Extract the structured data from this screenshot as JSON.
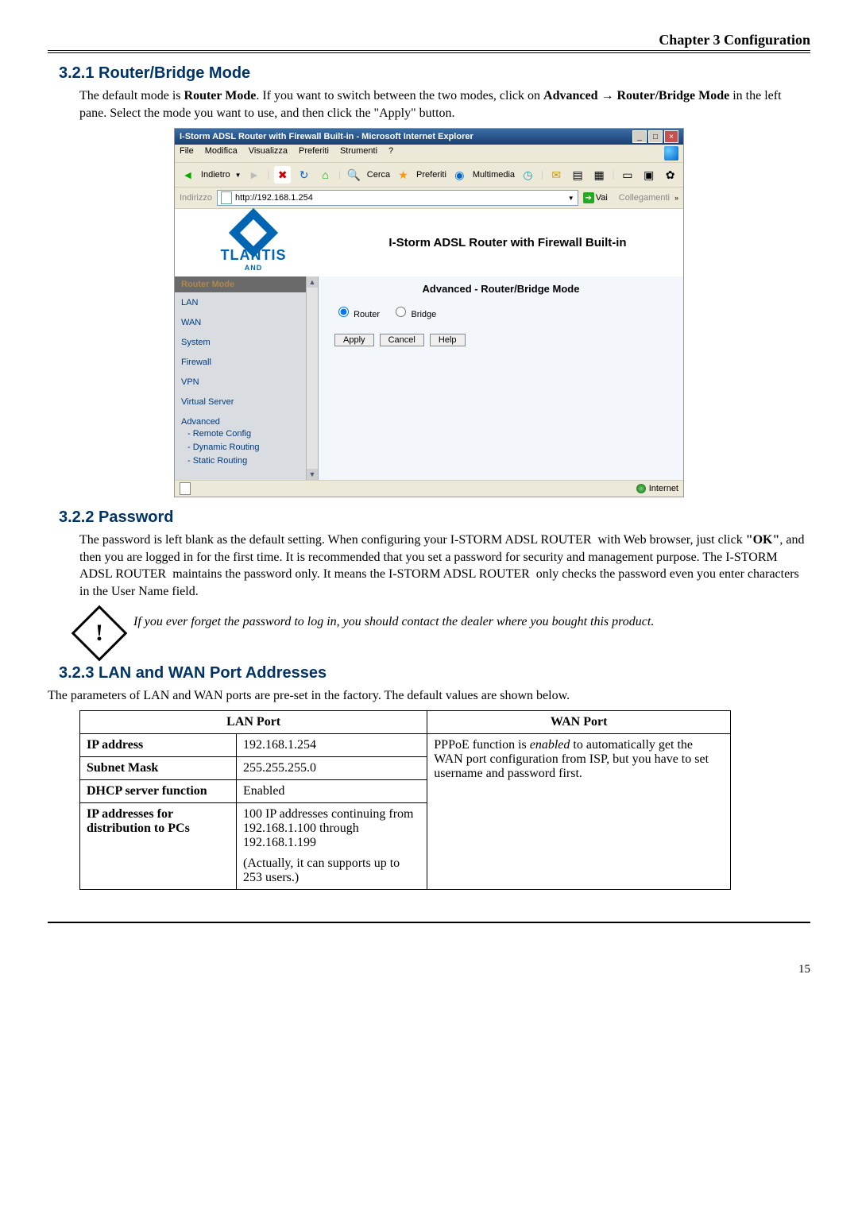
{
  "chapter_header": "Chapter 3 Configuration",
  "section_321": {
    "title": "3.2.1 Router/Bridge Mode",
    "para": "The default mode is Router Mode. If you want to switch between the two modes, click on Advanced → Router/Bridge Mode in the left pane. Select the mode you want to use, and then click the \"Apply\" button."
  },
  "screenshot": {
    "titlebar": "I-Storm ADSL Router with Firewall Built-in - Microsoft Internet Explorer",
    "menubar": [
      "File",
      "Modifica",
      "Visualizza",
      "Preferiti",
      "Strumenti",
      "?"
    ],
    "toolbar": {
      "back": "Indietro",
      "search": "Cerca",
      "fav": "Preferiti",
      "media": "Multimedia"
    },
    "address": {
      "label": "Indirizzo",
      "value": "http://192.168.1.254",
      "go": "Vai",
      "links": "Collegamenti"
    },
    "brand": "TLANTIS",
    "brand_sub": "AND",
    "page_title": "I-Storm ADSL Router with Firewall Built-in",
    "nav": {
      "top": "Router Mode",
      "items": [
        "LAN",
        "WAN",
        "System",
        "Firewall",
        "VPN",
        "Virtual Server",
        "Advanced"
      ],
      "subs": [
        "- Remote Config",
        "- Dynamic Routing",
        "- Static Routing"
      ]
    },
    "body": {
      "title": "Advanced - Router/Bridge Mode",
      "opt_router": "Router",
      "opt_bridge": "Bridge",
      "apply": "Apply",
      "cancel": "Cancel",
      "help": "Help"
    },
    "status": {
      "done_icon": "page",
      "zone": "Internet"
    }
  },
  "section_322": {
    "title": "3.2.2 Password",
    "para": "The password is left blank as the default setting. When configuring your I-STORM ADSL ROUTER  with Web browser, just click \"OK\", and then you are logged in for the first time. It is recommended that you set a password for security and management purpose. The I-STORM ADSL ROUTER  maintains the password only. It means the I-STORM ADSL ROUTER  only checks the password even you enter characters in the User Name field.",
    "note": "If you ever forget the password to log in, you should contact the dealer where you bought this product."
  },
  "section_323": {
    "title": "3.2.3 LAN and WAN Port Addresses",
    "intro": "The parameters of LAN and WAN ports are pre-set in the factory.  The default values are shown below.",
    "table": {
      "lan_header": "LAN Port",
      "wan_header": "WAN Port",
      "rows": {
        "ip_label": "IP address",
        "ip_value": "192.168.1.254",
        "mask_label": "Subnet Mask",
        "mask_value": "255.255.255.0",
        "dhcp_label": "DHCP server function",
        "dhcp_value": "Enabled",
        "dist_label": "IP addresses for distribution to PCs",
        "dist_value1": "100 IP addresses continuing from 192.168.1.100 through 192.168.1.199",
        "dist_value2": "(Actually, it can supports up to 253 users.)",
        "wan_value": "PPPoE function is enabled to automatically get the WAN port configuration from ISP, but you have to set username and password first."
      }
    }
  },
  "page_number": "15"
}
